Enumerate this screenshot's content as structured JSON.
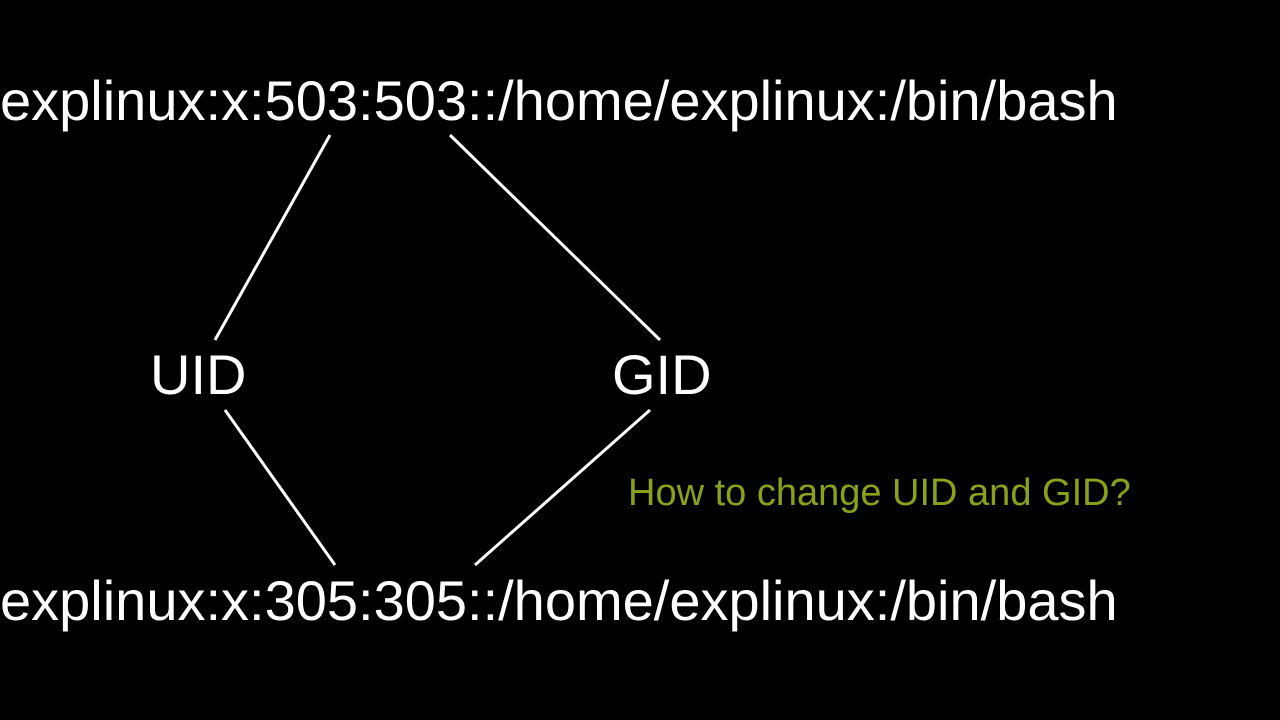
{
  "passwd_line_top": "explinux:x:503:503::/home/explinux:/bin/bash",
  "passwd_line_bottom": "explinux:x:305:305::/home/explinux:/bin/bash",
  "uid_label": "UID",
  "gid_label": "GID",
  "question": "How to change UID and GID?",
  "colors": {
    "background": "#000000",
    "text": "#ffffff",
    "accent": "#8ca019"
  },
  "diagram": {
    "description": "Two /etc/passwd-style entries showing a change of UID and GID from 503 to 305. Angled lines connect the UID and GID fields to their labels and to both entries.",
    "lines": [
      {
        "from": "top-uid-field",
        "to": "uid-label"
      },
      {
        "from": "top-gid-field",
        "to": "gid-label"
      },
      {
        "from": "uid-label",
        "to": "bottom-uid-field"
      },
      {
        "from": "gid-label",
        "to": "bottom-gid-field"
      }
    ]
  }
}
